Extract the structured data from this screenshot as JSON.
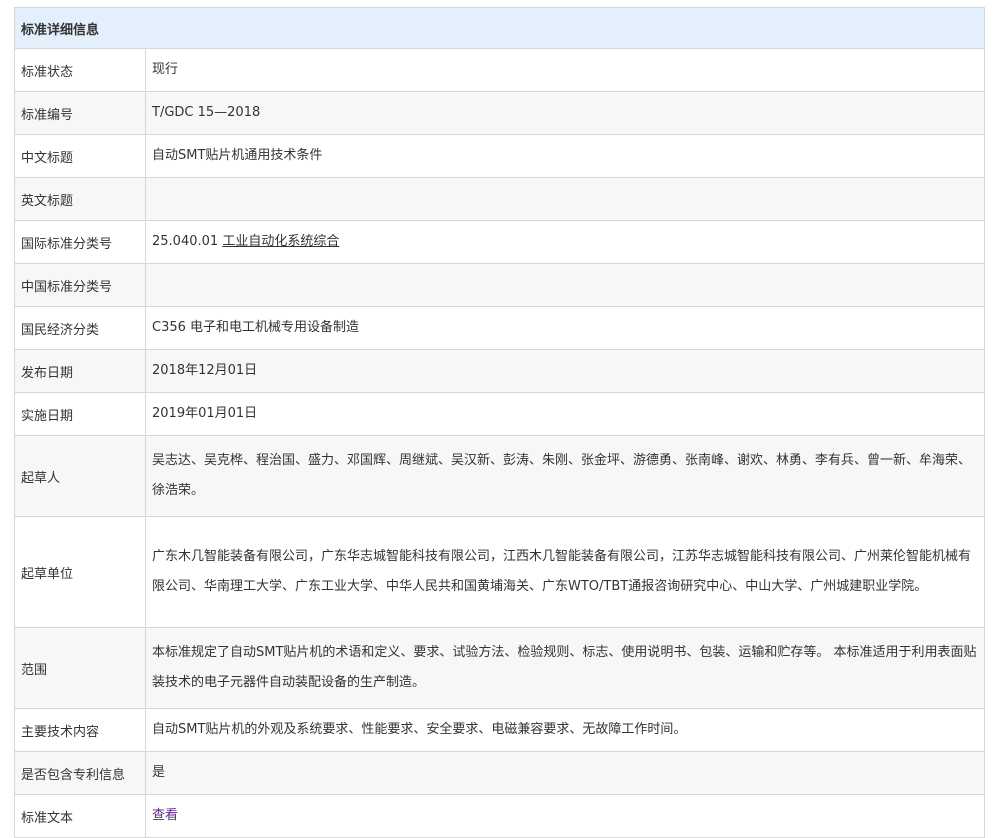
{
  "table": {
    "header": "标准详细信息",
    "rows": [
      {
        "label": "标准状态",
        "value": "现行"
      },
      {
        "label": "标准编号",
        "value": "T/GDC 15—2018"
      },
      {
        "label": "中文标题",
        "value": "自动SMT贴片机通用技术条件"
      },
      {
        "label": "英文标题",
        "value": ""
      },
      {
        "label": "国际标准分类号",
        "value_code": "25.040.01",
        "value_link": "工业自动化系统综合"
      },
      {
        "label": "中国标准分类号",
        "value": ""
      },
      {
        "label": "国民经济分类",
        "value": "C356 电子和电工机械专用设备制造"
      },
      {
        "label": "发布日期",
        "value": "2018年12月01日"
      },
      {
        "label": "实施日期",
        "value": "2019年01月01日"
      },
      {
        "label": "起草人",
        "value": "吴志达、吴克桦、程治国、盛力、邓国辉、周继斌、吴汉新、彭涛、朱刚、张金坪、游德勇、张南峰、谢欢、林勇、李有兵、曾一新、牟海荣、徐浩荣。"
      },
      {
        "label": "起草单位",
        "value": "广东木几智能装备有限公司，广东华志城智能科技有限公司，江西木几智能装备有限公司，江苏华志城智能科技有限公司、广州莱伦智能机械有限公司、华南理工大学、广东工业大学、中华人民共和国黄埔海关、广东WTO/TBT通报咨询研究中心、中山大学、广州城建职业学院。"
      },
      {
        "label": "范围",
        "value": "本标准规定了自动SMT贴片机的术语和定义、要求、试验方法、检验规则、标志、使用说明书、包装、运输和贮存等。 本标准适用于利用表面贴装技术的电子元器件自动装配设备的生产制造。"
      },
      {
        "label": "主要技术内容",
        "value": "自动SMT贴片机的外观及系统要求、性能要求、安全要求、电磁兼容要求、无故障工作时间。"
      },
      {
        "label": "是否包含专利信息",
        "value": "是"
      },
      {
        "label": "标准文本",
        "value_link": "查看"
      }
    ]
  }
}
